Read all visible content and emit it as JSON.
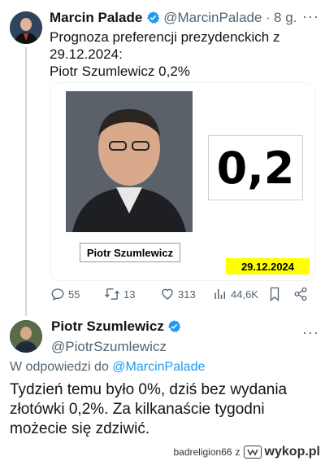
{
  "tweet": {
    "author_name": "Marcin Palade",
    "author_handle": "@MarcinPalade",
    "separator": "·",
    "time_ago": "8 g.",
    "text_line1": "Prognoza preferencji prezydenckich z",
    "text_line2": "29.12.2024:",
    "text_line3": "Piotr Szumlewicz 0,2%",
    "card": {
      "person_label": "Piotr Szumlewicz",
      "value": "0,2",
      "date": "29.12.2024"
    },
    "actions": {
      "replies": "55",
      "retweets": "13",
      "likes": "313",
      "views": "44,6K"
    }
  },
  "reply": {
    "author_name": "Piotr Szumlewicz",
    "author_handle": "@PiotrSzumlewicz",
    "replying_prefix": "W odpowiedzi do",
    "replying_to": "@MarcinPalade",
    "text_line1": "Tydzień temu było 0%, dziś bez wydania",
    "text_line2": "złotówki 0,2%. Za kilkanaście tygodni",
    "text_line3": "możecie się zdziwić."
  },
  "footer": {
    "username": "badreligion66",
    "conjunction": "z",
    "site": "wykop.pl"
  },
  "colors": {
    "verified_blue": "#1d9bf0",
    "link_blue": "#1d9bf0",
    "muted_gray": "#536471",
    "date_yellow": "#ffff00"
  }
}
